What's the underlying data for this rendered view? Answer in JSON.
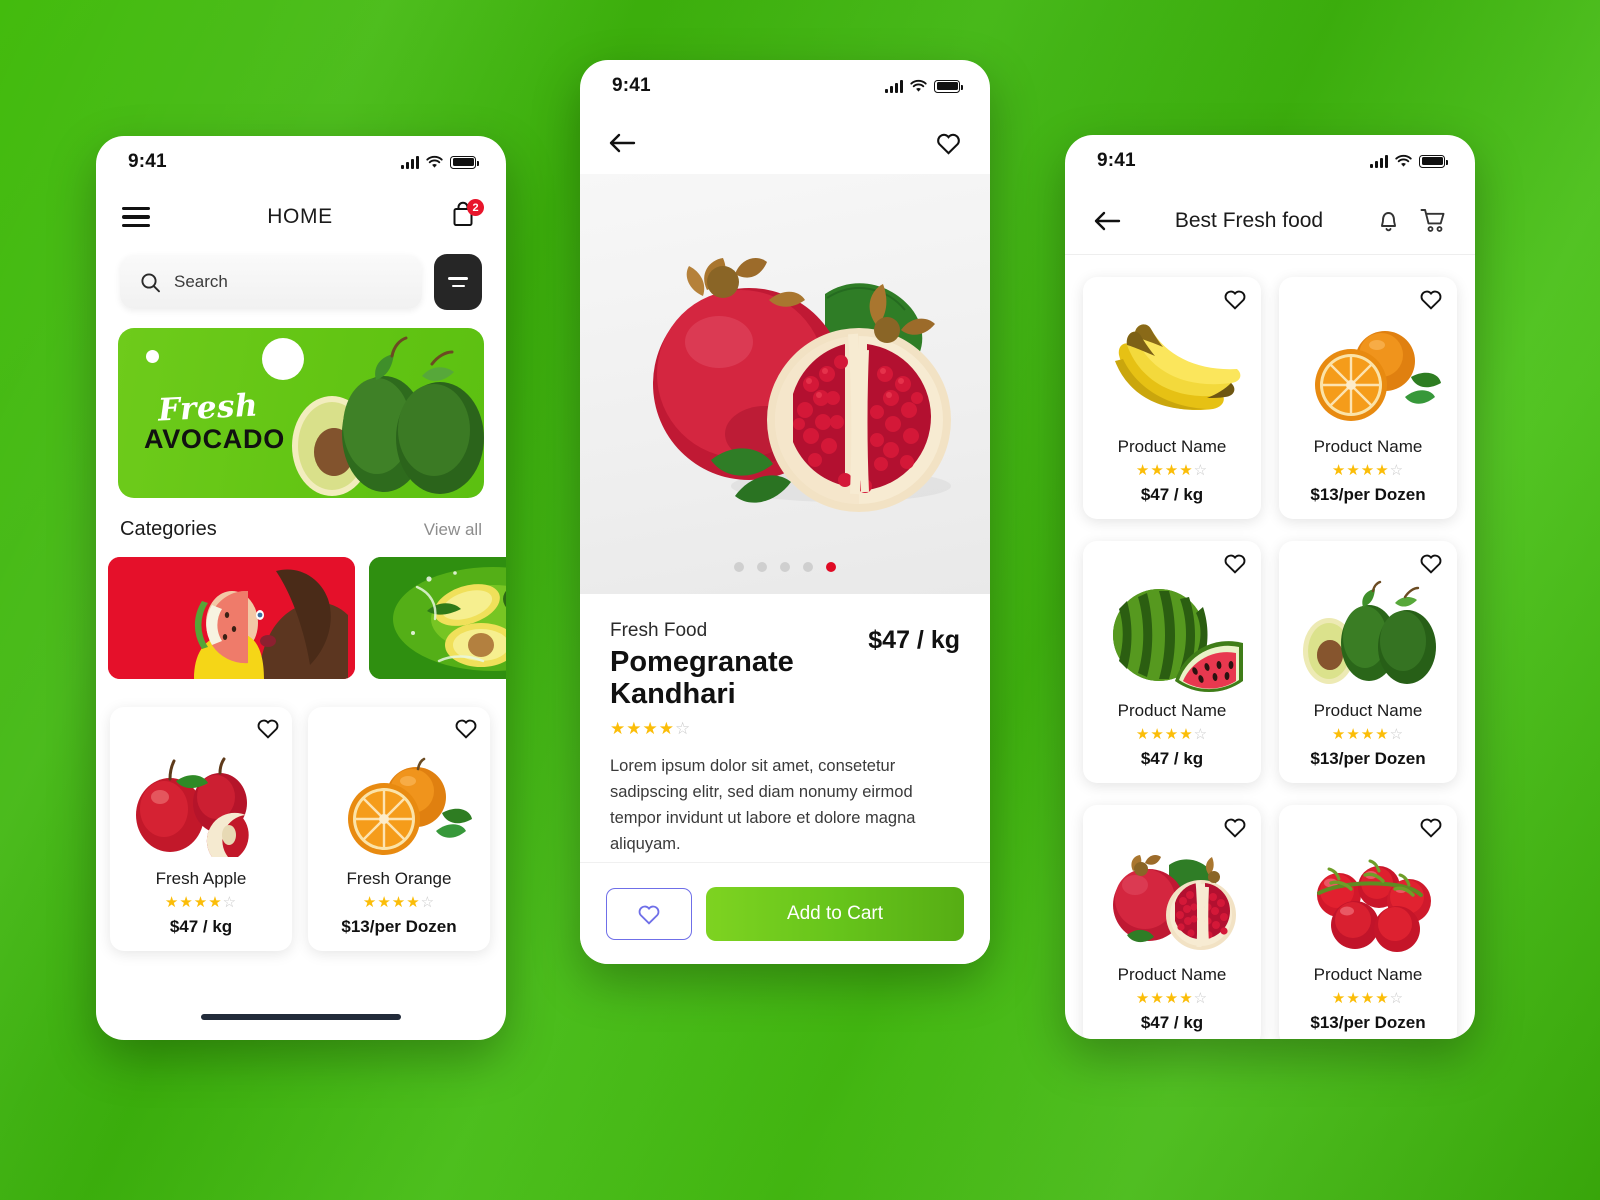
{
  "background": {
    "color": "#3cb40c"
  },
  "status_bar": {
    "time": "9:41",
    "icons": [
      "signal-icon",
      "wifi-icon",
      "battery-icon"
    ]
  },
  "phone_home": {
    "appbar": {
      "menu_icon": "hamburger-menu-icon",
      "title": "HOME",
      "cart_icon": "shopping-bag-icon",
      "cart_badge": "2"
    },
    "search": {
      "placeholder": "Search",
      "icon": "search-icon",
      "filter_icon": "filter-icon"
    },
    "banner": {
      "script_text": "Fresh",
      "title": "AVOCADO",
      "bg_color": "#63c514",
      "image": "avocado-image"
    },
    "categories_section": {
      "title": "Categories",
      "view_all": "View all"
    },
    "categories": [
      {
        "name": "watermelon-woman-category",
        "bg": "#e8102a"
      },
      {
        "name": "avocado-splash-category",
        "bg": "#2f8f10"
      }
    ],
    "products": [
      {
        "name": "Fresh Apple",
        "rating": 4,
        "price": "$47 / kg",
        "image": "apples-image"
      },
      {
        "name": "Fresh Orange",
        "rating": 4,
        "price": "$13/per Dozen",
        "image": "oranges-image"
      }
    ]
  },
  "phone_detail": {
    "appbar": {
      "back_icon": "back-arrow-icon",
      "favorite_icon": "heart-outline-icon"
    },
    "hero": {
      "image": "pomegranate-image",
      "dots_total": 5,
      "dots_active_index": 4,
      "active_dot_color": "#e00a24"
    },
    "product": {
      "category": "Fresh Food",
      "title": "Pomegranate Kandhari",
      "price": "$47 / kg",
      "rating": 4,
      "description": "Lorem ipsum dolor sit amet, consetetur sadipscing elitr, sed diam nonumy eirmod tempor invidunt ut labore et dolore magna aliquyam."
    },
    "actions": {
      "favorite_icon": "heart-outline-icon",
      "add_to_cart": "Add to Cart",
      "cart_color": "#66c41b"
    }
  },
  "phone_list": {
    "appbar": {
      "back_icon": "back-arrow-icon",
      "title": "Best Fresh food",
      "bell_icon": "bell-icon",
      "cart_icon": "shopping-cart-icon"
    },
    "products": [
      {
        "name": "Product Name",
        "rating": 4,
        "price": "$47 / kg",
        "image": "bananas-image"
      },
      {
        "name": "Product Name",
        "rating": 4,
        "price": "$13/per Dozen",
        "image": "oranges-image"
      },
      {
        "name": "Product Name",
        "rating": 4,
        "price": "$47 / kg",
        "image": "watermelon-image"
      },
      {
        "name": "Product Name",
        "rating": 4,
        "price": "$13/per Dozen",
        "image": "avocado-image"
      },
      {
        "name": "Product Name",
        "rating": 4,
        "price": "$47 / kg",
        "image": "pomegranate-image"
      },
      {
        "name": "Product Name",
        "rating": 4,
        "price": "$13/per Dozen",
        "image": "tomatoes-image"
      }
    ]
  }
}
